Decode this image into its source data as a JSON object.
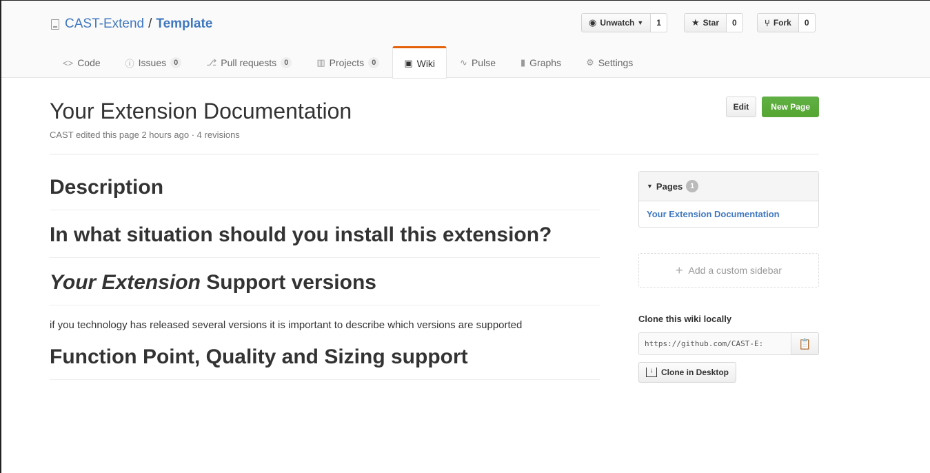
{
  "repo": {
    "owner": "CAST-Extend",
    "separator": "/",
    "name": "Template"
  },
  "actions": {
    "watch_label": "Unwatch",
    "watch_count": "1",
    "star_label": "Star",
    "star_count": "0",
    "fork_label": "Fork",
    "fork_count": "0"
  },
  "nav": {
    "code": "Code",
    "issues": "Issues",
    "issues_count": "0",
    "pulls": "Pull requests",
    "pulls_count": "0",
    "projects": "Projects",
    "projects_count": "0",
    "wiki": "Wiki",
    "pulse": "Pulse",
    "graphs": "Graphs",
    "settings": "Settings",
    "selected": "wiki",
    "accent_color": "#e36209"
  },
  "wiki": {
    "title": "Your Extension Documentation",
    "meta": "CAST edited this page 2 hours ago · 4 revisions",
    "edit_label": "Edit",
    "new_page_label": "New Page"
  },
  "content": {
    "h_description": "Description",
    "h_situation": "In what situation should you install this extension?",
    "h_support_em": "Your Extension",
    "h_support_rest": " Support versions",
    "p_support": "if you technology has released several versions it is important to describe which versions are supported",
    "h_function": "Function Point, Quality and Sizing support"
  },
  "sidebar": {
    "pages_label": "Pages",
    "pages_count": "1",
    "pages": [
      "Your Extension Documentation"
    ],
    "add_sidebar": "Add a custom sidebar",
    "clone_title": "Clone this wiki locally",
    "clone_url": "https://github.com/CAST-E:",
    "clone_desktop": "Clone in Desktop"
  },
  "colors": {
    "link": "#4078c0",
    "primary_button": "#55a532"
  }
}
